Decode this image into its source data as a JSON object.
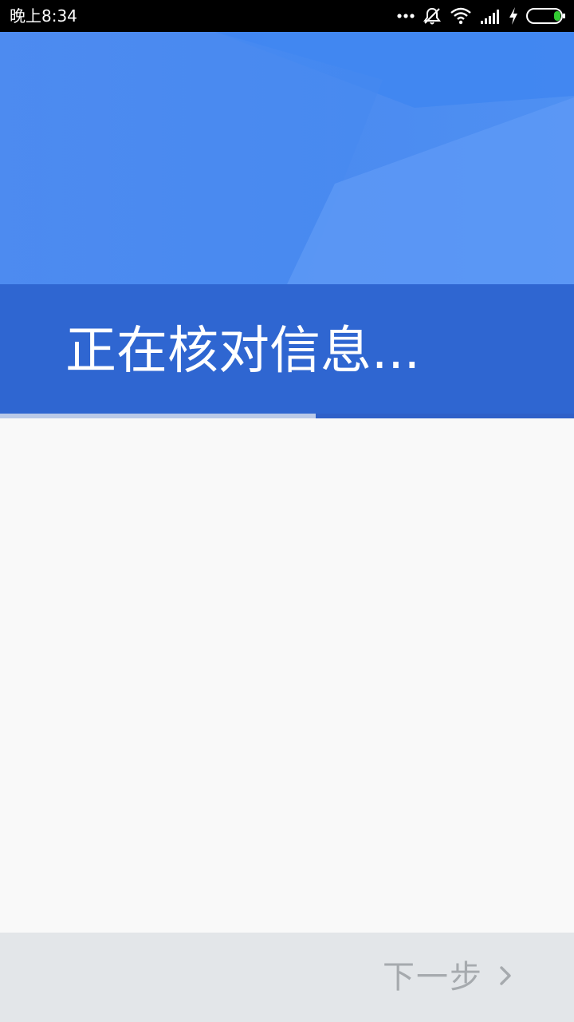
{
  "status_bar": {
    "time": "晚上8:34",
    "icons": [
      "more-dots-icon",
      "mute-alarm-icon",
      "wifi-icon",
      "signal-icon",
      "charging-icon",
      "battery-icon"
    ]
  },
  "header": {
    "title": "正在核对信息..."
  },
  "progress": {
    "fraction": 0.55
  },
  "footer": {
    "next_label": "下一步",
    "next_icon": "chevron-right-icon"
  },
  "colors": {
    "status_bar_bg": "#000000",
    "hero_blue": "#4a8af0",
    "title_band_blue": "#2f66d1",
    "progress_track": "#2f60c8",
    "progress_fill": "#b9c9e8",
    "content_bg": "#f9f9f9",
    "footer_bg": "#e3e6e9",
    "next_disabled": "#a6aaae",
    "battery_green": "#33cc33"
  }
}
